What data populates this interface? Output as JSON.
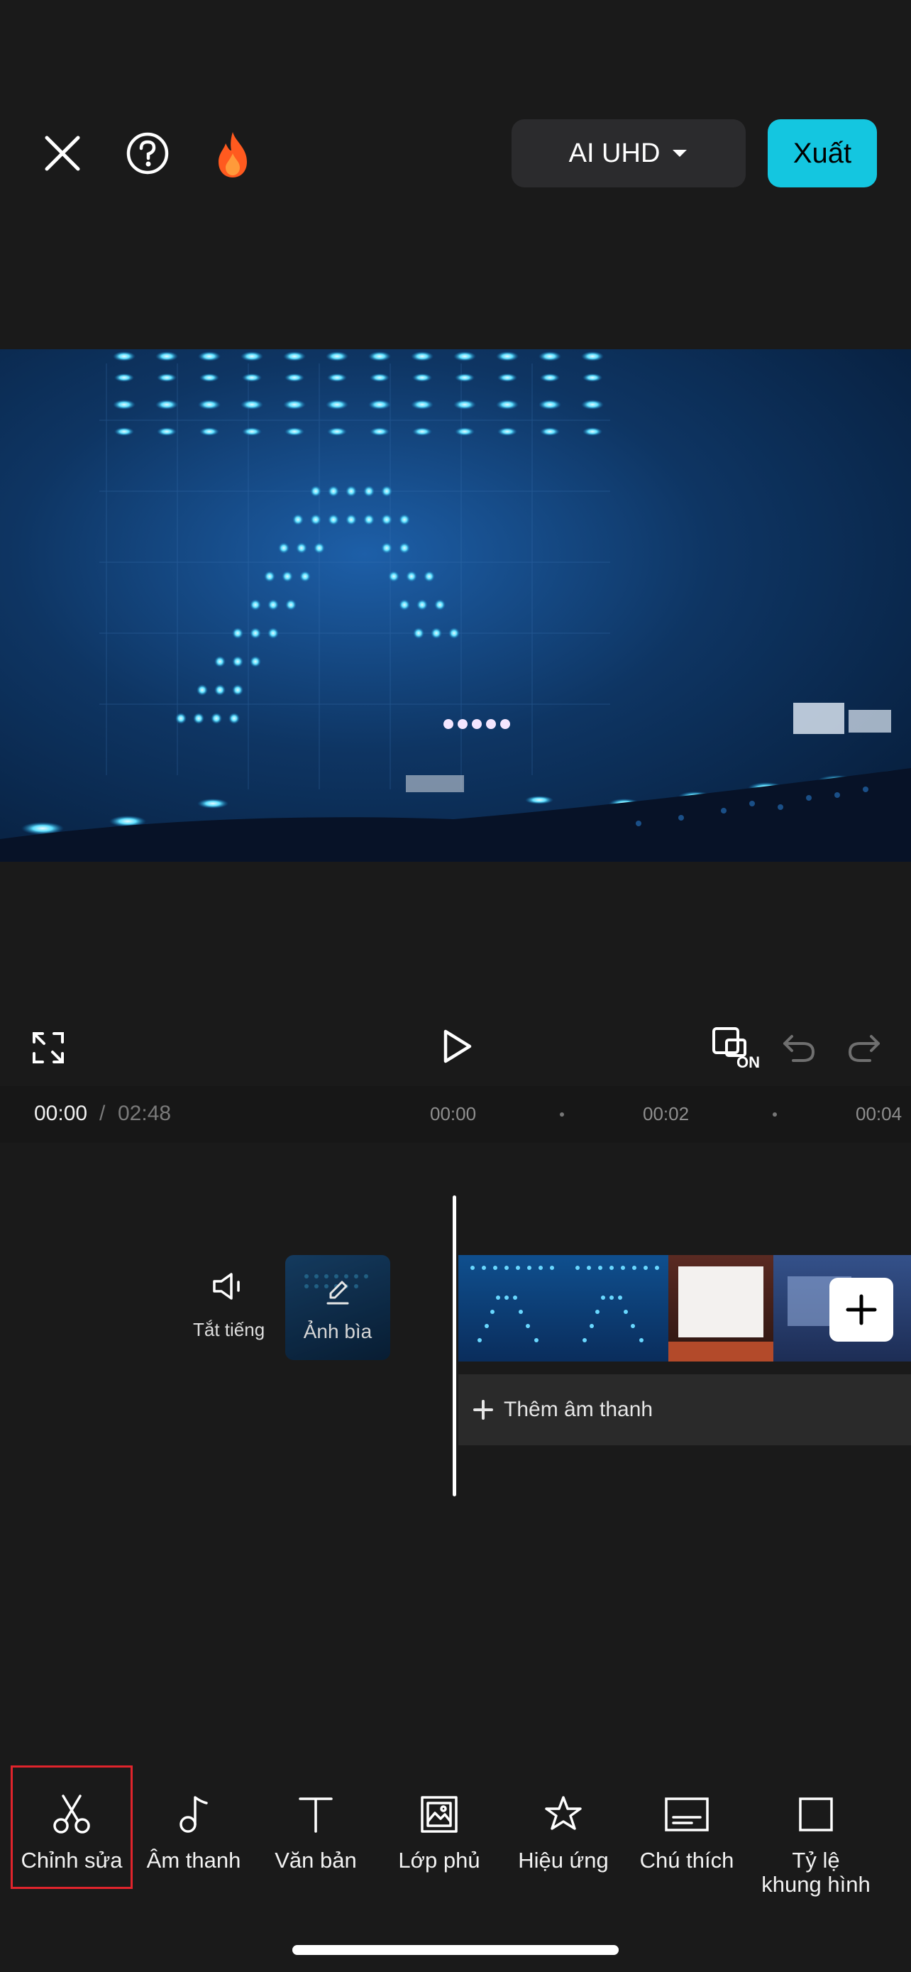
{
  "header": {
    "close_icon": "close-icon",
    "help_icon": "help-icon",
    "fire_icon": "fire-icon",
    "quality_label": "AI UHD",
    "export_label": "Xuất",
    "accent_color": "#14c6e0"
  },
  "preview": {
    "description_icon": "video-frame"
  },
  "controls": {
    "fullscreen_icon": "fullscreen-icon",
    "play_icon": "play-icon",
    "keyframe_icon": "keyframe-on-icon",
    "keyframe_badge": "ON",
    "undo_icon": "undo-icon",
    "redo_icon": "redo-icon"
  },
  "timeline": {
    "current_time": "00:00",
    "separator": "/",
    "total_time": "02:48",
    "ticks": [
      "00:00",
      "00:02",
      "00:04"
    ],
    "mute_label": "Tắt tiếng",
    "cover_label": "Ảnh bìa",
    "add_audio_label": "Thêm âm thanh"
  },
  "toolbar": {
    "items": [
      {
        "label": "Chỉnh sửa",
        "icon": "scissors-icon"
      },
      {
        "label": "Âm thanh",
        "icon": "music-note-icon"
      },
      {
        "label": "Văn bản",
        "icon": "text-icon"
      },
      {
        "label": "Lớp phủ",
        "icon": "overlay-icon"
      },
      {
        "label": "Hiệu ứng",
        "icon": "effects-star-icon"
      },
      {
        "label": "Chú thích",
        "icon": "captions-icon"
      },
      {
        "label": "Tỷ lệ\nkhung hình",
        "icon": "aspect-ratio-icon"
      }
    ],
    "highlight_color": "#e0242c"
  }
}
